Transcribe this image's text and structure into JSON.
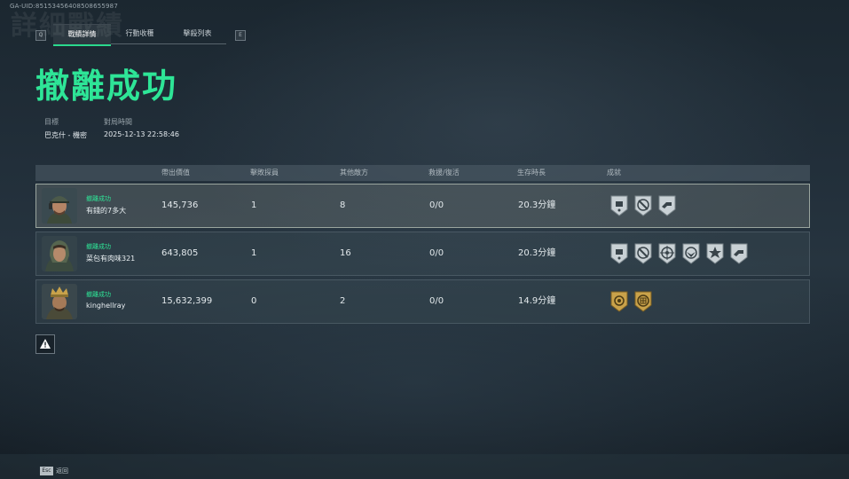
{
  "uid": "GA-UID:85153456408508655987",
  "bg_title": "詳細戰績",
  "tabs": {
    "prev_key": "Q",
    "next_key": "E",
    "items": [
      {
        "label": "戰績詳情",
        "active": true
      },
      {
        "label": "行動收穫",
        "active": false
      },
      {
        "label": "擊殺列表",
        "active": false
      }
    ]
  },
  "result_title": "撤離成功",
  "target": {
    "label": "目標",
    "value": "巴克什 - 機密"
  },
  "match_time": {
    "label": "對局時間",
    "value": "2025-12-13 22:58:46"
  },
  "columns": [
    "帶出價值",
    "擊敗探員",
    "其他敵方",
    "救援/復活",
    "生存時長",
    "成就"
  ],
  "players": [
    {
      "status": "撤離成功",
      "name": "有錢的7多大",
      "value": "145,736",
      "operators": "1",
      "others": "8",
      "rescue": "0/0",
      "survival": "20.3分鐘",
      "badges": [
        "shield-badge-icon",
        "wrench-badge-icon",
        "hand-badge-icon"
      ],
      "selected": true,
      "avatar": "avatar-cap-soldier"
    },
    {
      "status": "撤離成功",
      "name": "菜包有肉味321",
      "value": "643,805",
      "operators": "1",
      "others": "16",
      "rescue": "0/0",
      "survival": "20.3分鐘",
      "badges": [
        "shield-badge-icon",
        "wrench-badge-icon",
        "target-badge-icon",
        "eagle-badge-icon",
        "star-badge-icon",
        "hand-badge-icon"
      ],
      "selected": false,
      "avatar": "avatar-hood-soldier"
    },
    {
      "status": "撤離成功",
      "name": "kinghellray",
      "value": "15,632,399",
      "operators": "0",
      "others": "2",
      "rescue": "0/0",
      "survival": "14.9分鐘",
      "badges": [
        "gold-sun-badge-icon",
        "gold-grid-badge-icon"
      ],
      "selected": false,
      "avatar": "avatar-crown-soldier"
    }
  ],
  "footer": {
    "key": "Esc",
    "label": "返回"
  },
  "colors": {
    "accent": "#2ee597",
    "tab_underline": "#2bd98d",
    "gold": "#c9a24a"
  }
}
